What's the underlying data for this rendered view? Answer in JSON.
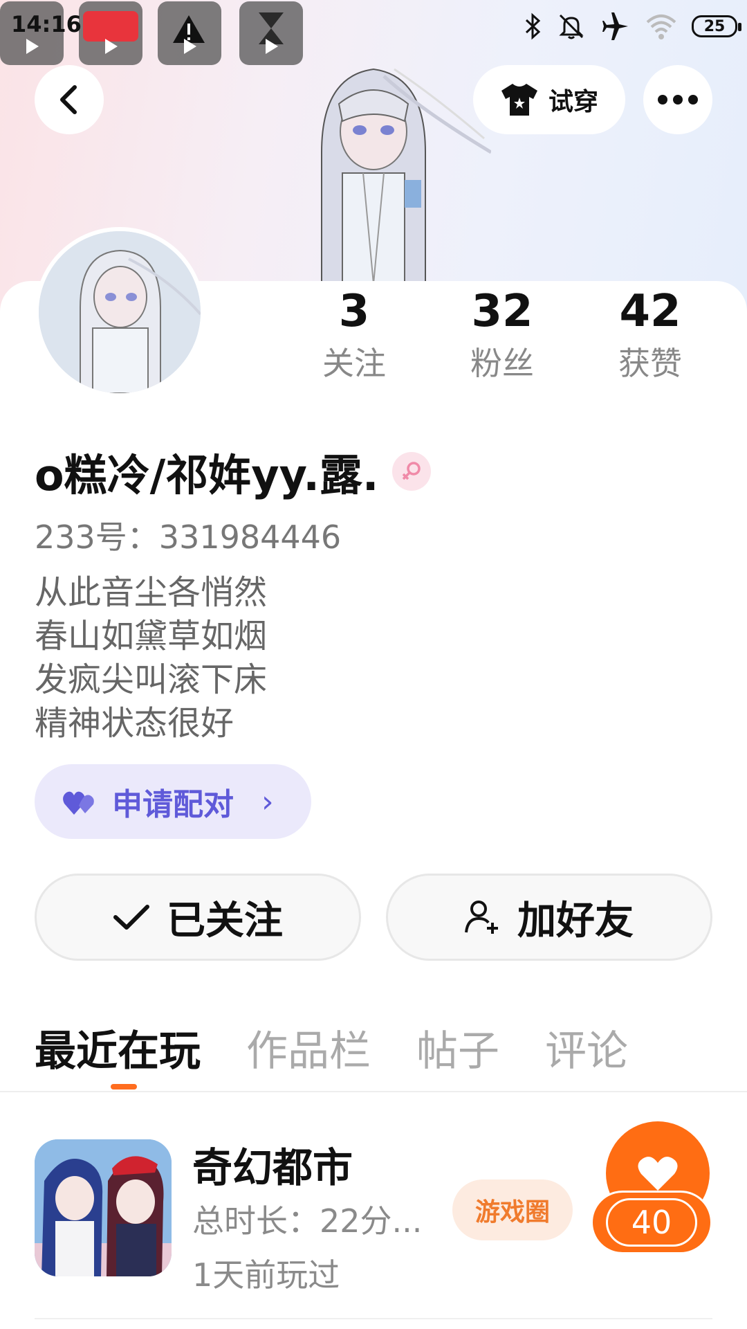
{
  "status_bar": {
    "time": "14:16",
    "battery": "25",
    "icons": [
      "bluetooth-icon",
      "bell-muted-icon",
      "airplane-icon",
      "wifi-icon",
      "battery-icon"
    ]
  },
  "header": {
    "try_on_label": "试穿"
  },
  "stats": {
    "following_count": "3",
    "following_label": "关注",
    "fans_count": "32",
    "fans_label": "粉丝",
    "likes_count": "42",
    "likes_label": "获赞"
  },
  "profile": {
    "name": "o糕冷/祁姩yy.露.",
    "uid": "233号：331984446",
    "bio_lines": [
      "从此音尘各悄然",
      "春山如黛草如烟",
      "发疯尖叫滚下床",
      "精神状态很好"
    ]
  },
  "pair": {
    "label": "申请配对",
    "chevron": "›"
  },
  "actions": {
    "follow_label": "已关注",
    "add_friend_label": "加好友"
  },
  "tabs": [
    "最近在玩",
    "作品栏",
    "帖子",
    "评论"
  ],
  "games": [
    {
      "title": "奇幻都市",
      "duration": "总时长：22分...",
      "last_played": "1天前玩过",
      "circle_label": "游戏圈",
      "like_count": "40"
    }
  ],
  "colors": {
    "accent": "#ff6d13",
    "pair": "#5f5ad9",
    "pair_bg": "#ebe9fb"
  }
}
